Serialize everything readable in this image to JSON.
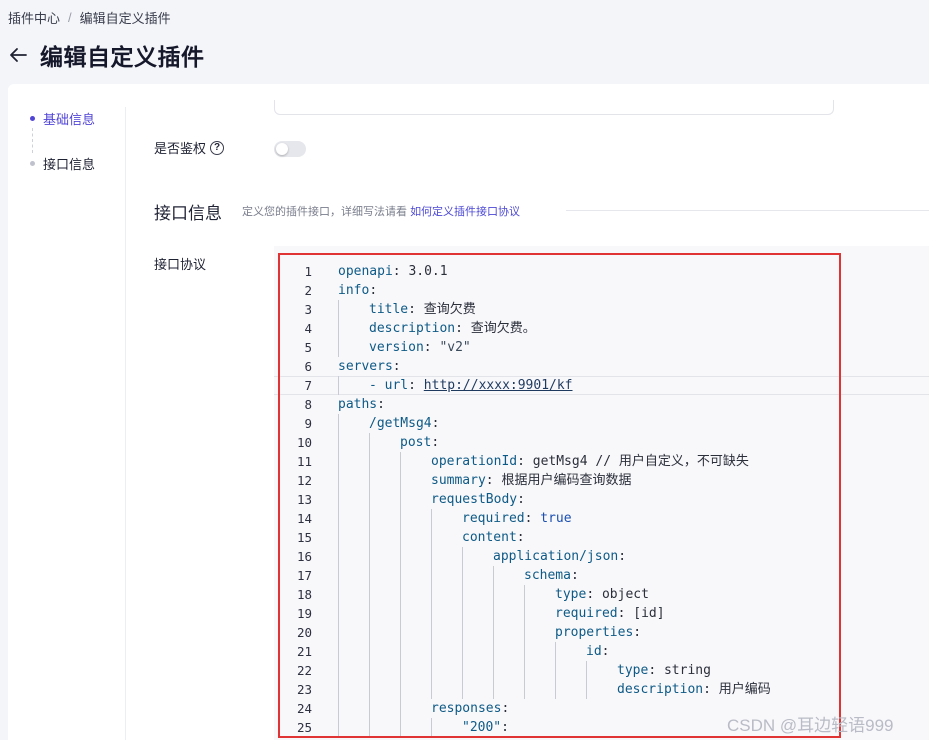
{
  "breadcrumb": {
    "parent": "插件中心",
    "separator": "/",
    "current": "编辑自定义插件"
  },
  "page_title": "编辑自定义插件",
  "sidebar": {
    "items": [
      {
        "label": "基础信息",
        "active": true
      },
      {
        "label": "接口信息",
        "active": false
      }
    ]
  },
  "auth": {
    "label": "是否鉴权",
    "help_glyph": "?",
    "enabled": false
  },
  "section": {
    "title": "接口信息",
    "desc": "定义您的插件接口，详细写法请看",
    "link": "如何定义插件接口协议"
  },
  "protocol": {
    "label": "接口协议"
  },
  "code_lines": [
    {
      "n": "1",
      "indent": 0,
      "key": "openapi",
      "colon": ": ",
      "val": "3.0.1",
      "type": "v"
    },
    {
      "n": "2",
      "indent": 0,
      "key": "info",
      "colon": ":",
      "val": "",
      "type": "v"
    },
    {
      "n": "3",
      "indent": 1,
      "key": "title",
      "colon": ": ",
      "val": "查询欠费",
      "type": "v"
    },
    {
      "n": "4",
      "indent": 1,
      "key": "description",
      "colon": ": ",
      "val": "查询欠费。",
      "type": "v"
    },
    {
      "n": "5",
      "indent": 1,
      "key": "version",
      "colon": ": ",
      "val": "\"v2\"",
      "type": "s"
    },
    {
      "n": "6",
      "indent": 0,
      "key": "servers",
      "colon": ":",
      "val": "",
      "type": "v"
    },
    {
      "n": "7",
      "indent": 1,
      "key": "- url",
      "colon": ": ",
      "val": "http://xxxx:9901/kf",
      "type": "url"
    },
    {
      "n": "8",
      "indent": 0,
      "key": "paths",
      "colon": ":",
      "val": "",
      "type": "v"
    },
    {
      "n": "9",
      "indent": 1,
      "key": "/getMsg4",
      "colon": ":",
      "val": "",
      "type": "v"
    },
    {
      "n": "10",
      "indent": 2,
      "key": "post",
      "colon": ":",
      "val": "",
      "type": "v"
    },
    {
      "n": "11",
      "indent": 3,
      "key": "operationId",
      "colon": ": ",
      "val": "getMsg4 // 用户自定义，不可缺失",
      "type": "v"
    },
    {
      "n": "12",
      "indent": 3,
      "key": "summary",
      "colon": ": ",
      "val": "根据用户编码查询数据",
      "type": "v"
    },
    {
      "n": "13",
      "indent": 3,
      "key": "requestBody",
      "colon": ":",
      "val": "",
      "type": "v"
    },
    {
      "n": "14",
      "indent": 4,
      "key": "required",
      "colon": ": ",
      "val": "true",
      "type": "kw"
    },
    {
      "n": "15",
      "indent": 4,
      "key": "content",
      "colon": ":",
      "val": "",
      "type": "v"
    },
    {
      "n": "16",
      "indent": 5,
      "key": "application/json",
      "colon": ":",
      "val": "",
      "type": "v"
    },
    {
      "n": "17",
      "indent": 6,
      "key": "schema",
      "colon": ":",
      "val": "",
      "type": "v"
    },
    {
      "n": "18",
      "indent": 7,
      "key": "type",
      "colon": ": ",
      "val": "object",
      "type": "v"
    },
    {
      "n": "19",
      "indent": 7,
      "key": "required",
      "colon": ": ",
      "val": "[id]",
      "type": "v"
    },
    {
      "n": "20",
      "indent": 7,
      "key": "properties",
      "colon": ":",
      "val": "",
      "type": "v"
    },
    {
      "n": "21",
      "indent": 8,
      "key": "id",
      "colon": ":",
      "val": "",
      "type": "v"
    },
    {
      "n": "22",
      "indent": 9,
      "key": "type",
      "colon": ": ",
      "val": "string",
      "type": "v"
    },
    {
      "n": "23",
      "indent": 9,
      "key": "description",
      "colon": ": ",
      "val": "用户编码",
      "type": "v"
    },
    {
      "n": "24",
      "indent": 3,
      "key": "responses",
      "colon": ":",
      "val": "",
      "type": "v"
    },
    {
      "n": "25",
      "indent": 4,
      "key": "\"200\"",
      "colon": ":",
      "val": "",
      "type": "s"
    }
  ],
  "watermark": "CSDN @耳边轻语999",
  "colors": {
    "accent": "#5145d6",
    "highlight_border": "#e03434",
    "link": "#4d49d4"
  }
}
